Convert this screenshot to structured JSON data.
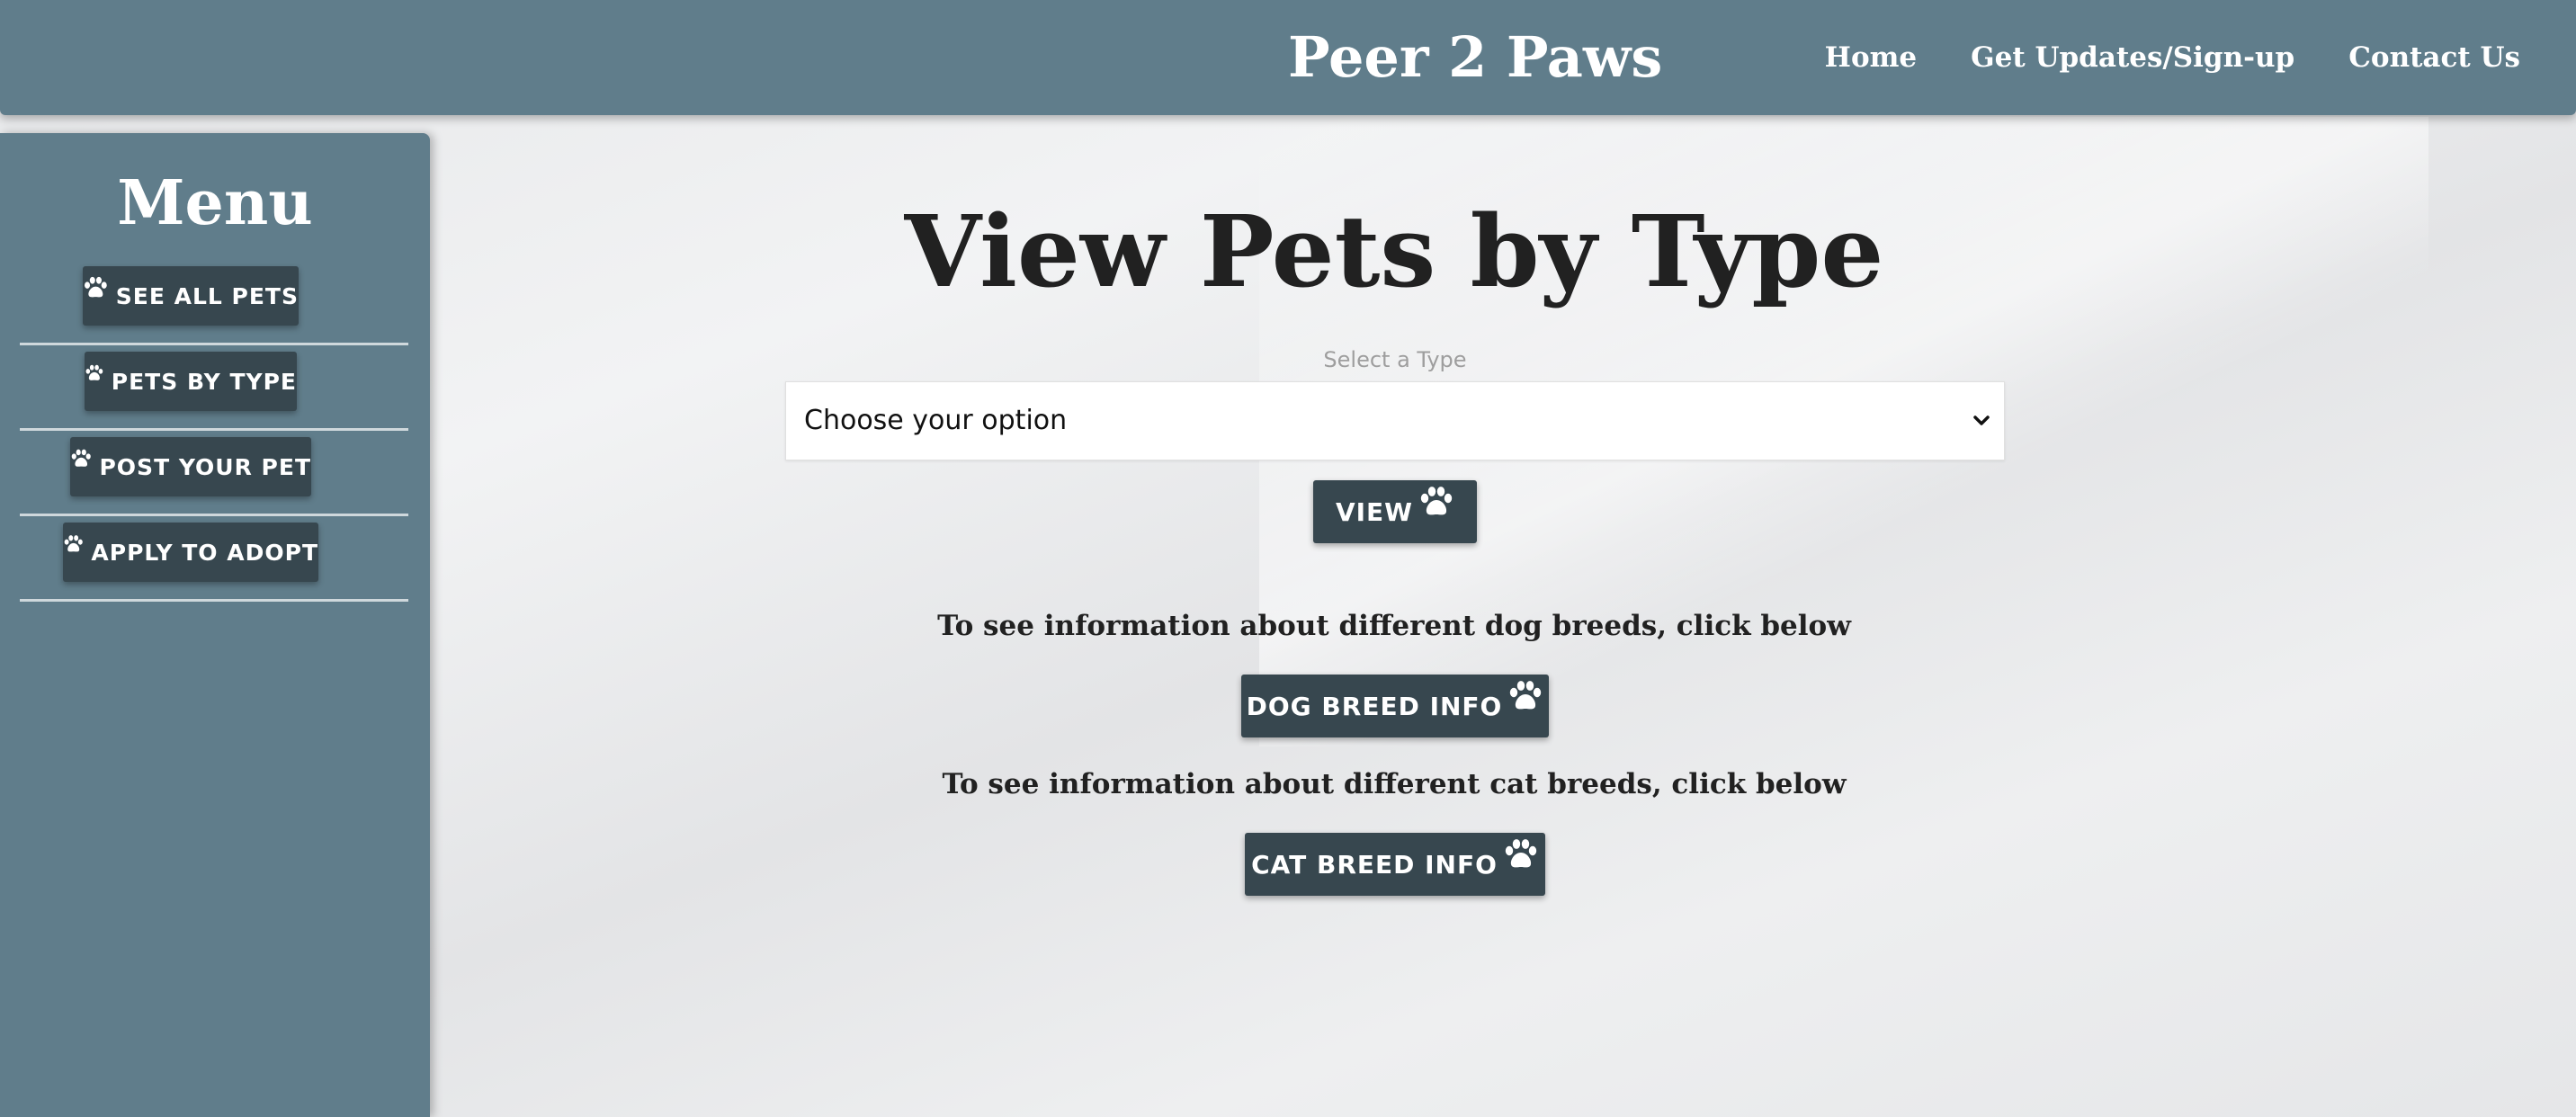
{
  "header": {
    "brand": "Peer 2 Paws",
    "nav": [
      "Home",
      "Get Updates/Sign-up",
      "Contact Us"
    ]
  },
  "sidebar": {
    "title": "Menu",
    "items": [
      {
        "label": "SEE ALL PETS",
        "icon": "paw-icon"
      },
      {
        "label": "PETS BY TYPE",
        "icon": "paw-icon"
      },
      {
        "label": "POST YOUR PET",
        "icon": "paw-icon"
      },
      {
        "label": "APPLY TO ADOPT",
        "icon": "paw-icon"
      }
    ]
  },
  "main": {
    "title": "View Pets by Type",
    "select": {
      "label": "Select a Type",
      "value": "Choose your option"
    },
    "view_button": "VIEW",
    "dog_info_text": "To see information about different dog breeds, click below",
    "dog_button": "DOG BREED INFO",
    "cat_info_text": "To see information about different cat breeds, click below",
    "cat_button": "CAT BREED INFO"
  },
  "colors": {
    "header_bg": "#607d8b",
    "sidebar_bg": "#607d8b",
    "button_bg": "#37474f",
    "text_dark": "#212121",
    "page_bg": "#eceff1"
  }
}
